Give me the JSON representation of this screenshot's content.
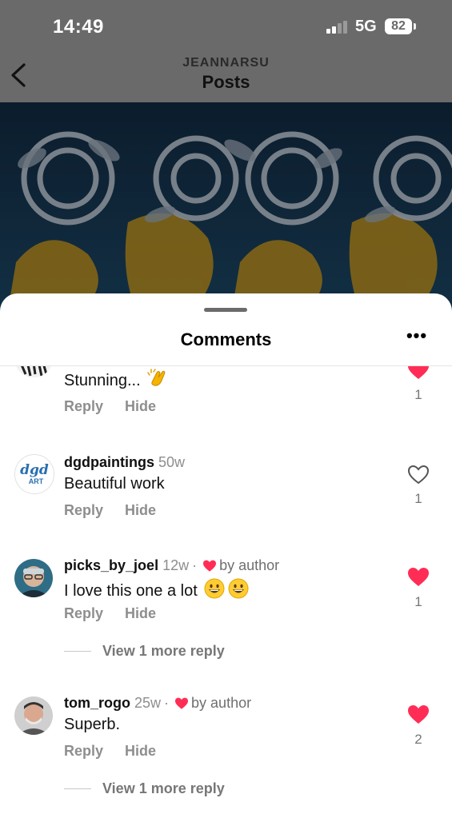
{
  "status_bar": {
    "time": "14:49",
    "network": "5G",
    "battery": "82"
  },
  "header": {
    "username": "JEANNARSU",
    "title": "Posts"
  },
  "sheet": {
    "title": "Comments"
  },
  "comments": [
    {
      "username": "",
      "ago": "",
      "text": "Stunning...",
      "emoji": "clapping-hands",
      "reply_label": "Reply",
      "hide_label": "Hide",
      "liked": true,
      "likes": "1"
    },
    {
      "username": "dgdpaintings",
      "ago": "50w",
      "text": "Beautiful work",
      "avatar_text": "dgd",
      "avatar_subtext": "ART",
      "reply_label": "Reply",
      "hide_label": "Hide",
      "liked": false,
      "likes": "1"
    },
    {
      "username": "picks_by_joel",
      "ago": "12w",
      "by_author": "by author",
      "text": "I love this one a lot",
      "emoji": "grinning-face x2",
      "reply_label": "Reply",
      "hide_label": "Hide",
      "liked": true,
      "likes": "1",
      "view_replies": "View 1 more reply"
    },
    {
      "username": "tom_rogo",
      "ago": "25w",
      "by_author": "by author",
      "text": "Superb.",
      "reply_label": "Reply",
      "hide_label": "Hide",
      "liked": true,
      "likes": "2",
      "view_replies": "View 1 more reply"
    }
  ],
  "colors": {
    "like_red": "#ff2d55",
    "muted_text": "#8e8e8e",
    "dim_overlay": "#6a6a6a"
  }
}
